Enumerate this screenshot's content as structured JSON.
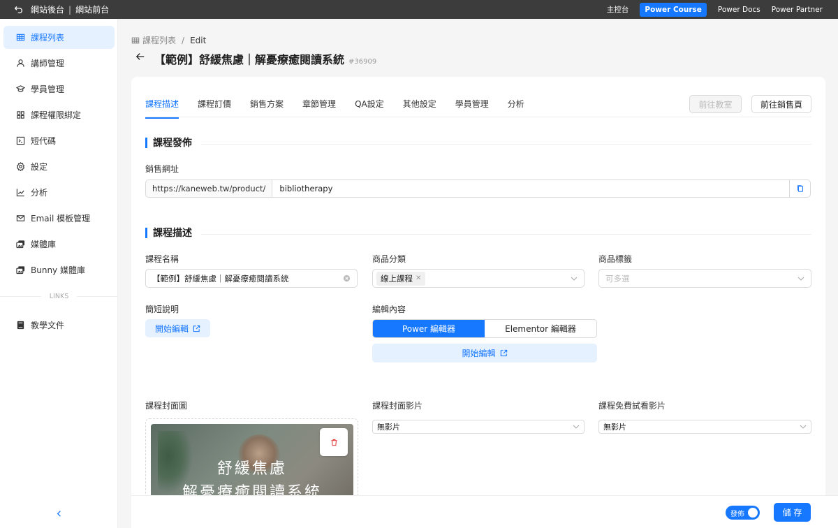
{
  "topbar": {
    "left": [
      "網站後台",
      "網站前台"
    ],
    "right": [
      {
        "label": "主控台",
        "active": false
      },
      {
        "label": "Power Course",
        "active": true
      },
      {
        "label": "Power Docs",
        "active": false
      },
      {
        "label": "Power Partner",
        "active": false
      }
    ]
  },
  "sidebar": {
    "items": [
      {
        "label": "課程列表",
        "icon": "table-icon",
        "active": true
      },
      {
        "label": "講師管理",
        "icon": "user-icon"
      },
      {
        "label": "學員管理",
        "icon": "graduation-icon"
      },
      {
        "label": "課程權限綁定",
        "icon": "apps-icon"
      },
      {
        "label": "短代碼",
        "icon": "code-icon"
      },
      {
        "label": "設定",
        "icon": "gear-icon"
      },
      {
        "label": "分析",
        "icon": "line-chart-icon"
      },
      {
        "label": "Email 模板管理",
        "icon": "mail-icon"
      },
      {
        "label": "媒體庫",
        "icon": "images-icon"
      },
      {
        "label": "Bunny 媒體庫",
        "icon": "images-icon"
      }
    ],
    "links_label": "LINKS",
    "links": [
      {
        "label": "教學文件",
        "icon": "book-icon"
      }
    ]
  },
  "breadcrumb": {
    "parent": "課程列表",
    "current": "Edit"
  },
  "page": {
    "title": "【範例】舒緩焦慮｜解憂療癒閱讀系統",
    "id": "#36909"
  },
  "tabs": [
    "課程描述",
    "課程訂價",
    "銷售方案",
    "章節管理",
    "QA設定",
    "其他設定",
    "學員管理",
    "分析"
  ],
  "actions": {
    "classroom": "前往教室",
    "sales_page": "前往銷售頁"
  },
  "publish_section": {
    "title": "課程發佈",
    "url_label": "銷售網址",
    "url_prefix": "https://kaneweb.tw/product/",
    "url_slug": "bibliotherapy"
  },
  "desc_section": {
    "title": "課程描述",
    "name_label": "課程名稱",
    "name_value": "【範例】舒緩焦慮｜解憂療癒閱讀系統",
    "category_label": "商品分類",
    "category_tag": "線上課程",
    "tags_label": "商品標籤",
    "tags_placeholder": "可多選",
    "short_desc_label": "簡短說明",
    "start_edit": "開始編輯",
    "editor_label": "編輯內容",
    "editor_options": [
      "Power 編輯器",
      "Elementor 編輯器"
    ],
    "cover_label": "課程封面圖",
    "cover_video_label": "課程封面影片",
    "cover_video_value": "無影片",
    "trial_video_label": "課程免費試看影片",
    "trial_video_value": "無影片",
    "cover_text": [
      "舒緩焦慮",
      "解憂療癒閱讀系統"
    ]
  },
  "footer": {
    "publish": "發佈",
    "publish_on": true,
    "save": "儲 存"
  },
  "colors": {
    "accent": "#1677ff",
    "topbar": "#3c3c3c"
  }
}
